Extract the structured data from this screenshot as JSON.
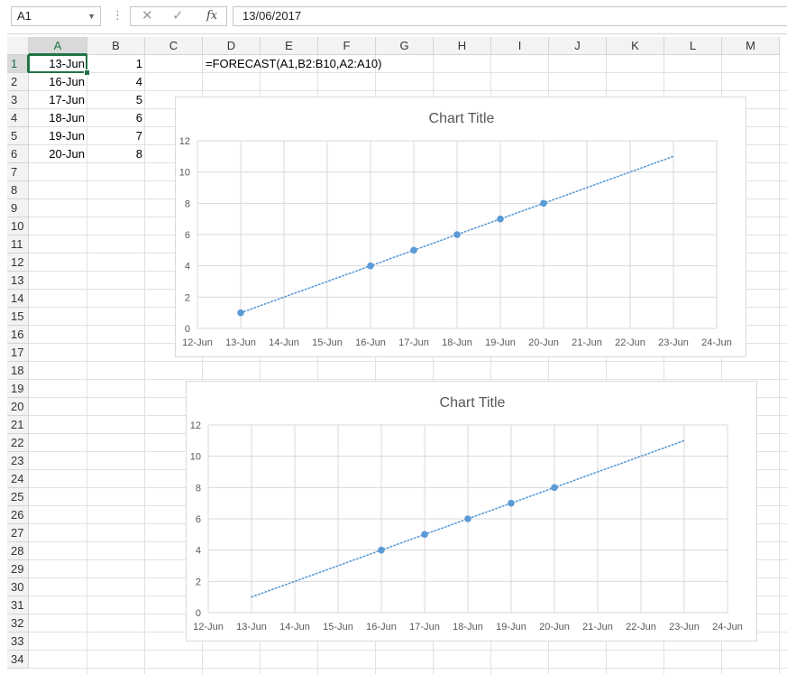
{
  "name_box": "A1",
  "formula_bar_value": "13/06/2017",
  "icons": {
    "cancel": "cross-icon",
    "enter": "check-icon",
    "function": "fx-icon"
  },
  "fx_label": "fx",
  "columns": [
    "A",
    "B",
    "C",
    "D",
    "E",
    "F",
    "G",
    "H",
    "I",
    "J",
    "K",
    "L",
    "M"
  ],
  "rows": [
    "1",
    "2",
    "3",
    "4",
    "5",
    "6",
    "7",
    "8",
    "9",
    "10",
    "11",
    "12",
    "13",
    "14",
    "15",
    "16",
    "17",
    "18",
    "19",
    "20",
    "21",
    "22",
    "23",
    "24",
    "25",
    "26",
    "27",
    "28",
    "29",
    "30",
    "31",
    "32",
    "33",
    "34"
  ],
  "cells": {
    "col_a": [
      "13-Jun",
      "16-Jun",
      "17-Jun",
      "18-Jun",
      "19-Jun",
      "20-Jun"
    ],
    "col_b": [
      "1",
      "4",
      "5",
      "6",
      "7",
      "8"
    ],
    "d1": "=FORECAST(A1,B2:B10,A2:A10)"
  },
  "colors": {
    "accent": "#217346",
    "series": "#5b9bd5"
  },
  "chart_data": [
    {
      "type": "scatter",
      "title": "Chart Title",
      "x_ticks": [
        "12-Jun",
        "13-Jun",
        "14-Jun",
        "15-Jun",
        "16-Jun",
        "17-Jun",
        "18-Jun",
        "19-Jun",
        "20-Jun",
        "21-Jun",
        "22-Jun",
        "23-Jun",
        "24-Jun"
      ],
      "y_ticks": [
        "0",
        "2",
        "4",
        "6",
        "8",
        "10",
        "12"
      ],
      "xlim": [
        "12-Jun",
        "24-Jun"
      ],
      "ylim": [
        0,
        12
      ],
      "grid": true,
      "points": [
        {
          "x": "13-Jun",
          "y": 1
        },
        {
          "x": "16-Jun",
          "y": 4
        },
        {
          "x": "17-Jun",
          "y": 5
        },
        {
          "x": "18-Jun",
          "y": 6
        },
        {
          "x": "19-Jun",
          "y": 7
        },
        {
          "x": "20-Jun",
          "y": 8
        }
      ],
      "trendline": {
        "style": "dotted",
        "from": {
          "x": "13-Jun",
          "y": 1
        },
        "to": {
          "x": "23-Jun",
          "y": 11
        }
      }
    },
    {
      "type": "scatter",
      "title": "Chart Title",
      "x_ticks": [
        "12-Jun",
        "13-Jun",
        "14-Jun",
        "15-Jun",
        "16-Jun",
        "17-Jun",
        "18-Jun",
        "19-Jun",
        "20-Jun",
        "21-Jun",
        "22-Jun",
        "23-Jun",
        "24-Jun"
      ],
      "y_ticks": [
        "0",
        "2",
        "4",
        "6",
        "8",
        "10",
        "12"
      ],
      "xlim": [
        "12-Jun",
        "24-Jun"
      ],
      "ylim": [
        0,
        12
      ],
      "grid": true,
      "points": [
        {
          "x": "16-Jun",
          "y": 4
        },
        {
          "x": "17-Jun",
          "y": 5
        },
        {
          "x": "18-Jun",
          "y": 6
        },
        {
          "x": "19-Jun",
          "y": 7
        },
        {
          "x": "20-Jun",
          "y": 8
        }
      ],
      "trendline": {
        "style": "dotted",
        "from": {
          "x": "13-Jun",
          "y": 1
        },
        "to": {
          "x": "23-Jun",
          "y": 11
        }
      }
    }
  ]
}
